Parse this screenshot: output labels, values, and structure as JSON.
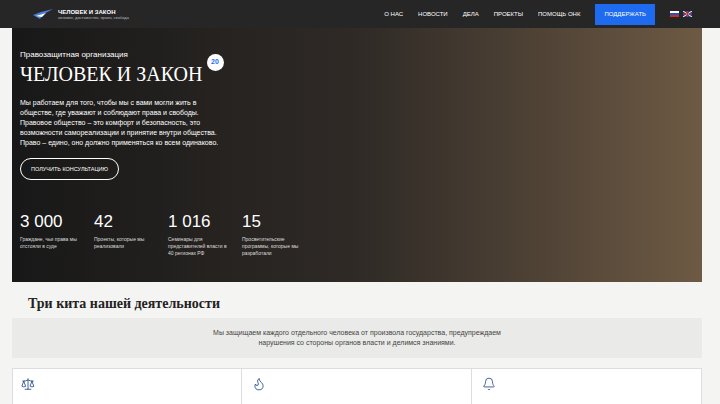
{
  "header": {
    "logo_title": "ЧЕЛОВЕК И ЗАКОН",
    "logo_subtitle": "человек, достоинство, право, свобода",
    "nav": [
      "О НАС",
      "НОВОСТИ",
      "ДЕЛА",
      "ПРОЕКТЫ",
      "ПОМОЩЬ ОНК"
    ],
    "donate_button": "ПОДДЕРЖАТЬ"
  },
  "hero": {
    "kicker": "Правозащитная организация",
    "title": "ЧЕЛОВЕК И ЗАКОН",
    "badge": "20",
    "text": "Мы работаем для того, чтобы мы с вами могли жить в обществе, где уважают и соблюдают права и свободы. Правовое общество – это комфорт и безопасность, это возможности самореализации и принятие внутри общества. Право – едино, оно должно применяться ко всем одинаково.",
    "button": "ПОЛУЧИТЬ КОНСУЛЬТАЦИЮ",
    "stats": [
      {
        "value": "3 000",
        "label": "Граждане, чьи права мы отстояли в суде"
      },
      {
        "value": "42",
        "label": "Проекты, которые мы реализовали"
      },
      {
        "value": "1 016",
        "label": "Семинары для представителей власти в 40 регионах РФ"
      },
      {
        "value": "15",
        "label": "Просветительские программы, которые мы разработали"
      }
    ]
  },
  "section": {
    "title": "Три кита нашей деятельности",
    "intro": "Мы защищаем каждого отдельного человека от произвола государства, предупреждаем нарушения со стороны органов власти и делимся знаниями."
  }
}
